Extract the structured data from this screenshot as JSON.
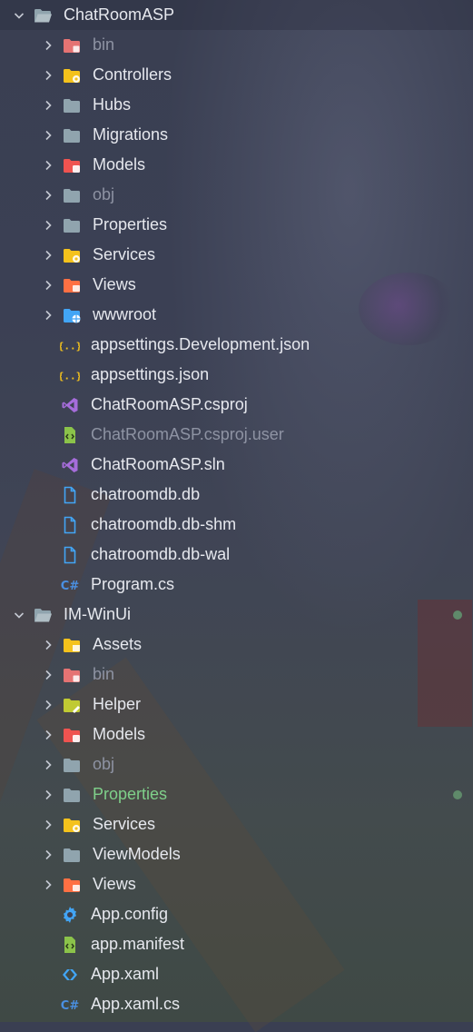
{
  "explorer": {
    "projects": [
      {
        "name": "ChatRoomASP",
        "items": [
          {
            "label": "bin",
            "kind": "folder",
            "icon": "folder-bin-icon",
            "color": "#e57373",
            "dim": true
          },
          {
            "label": "Controllers",
            "kind": "folder",
            "icon": "folder-controllers-icon",
            "color": "#f4c21c"
          },
          {
            "label": "Hubs",
            "kind": "folder",
            "icon": "folder-icon",
            "color": "#90a4ae"
          },
          {
            "label": "Migrations",
            "kind": "folder",
            "icon": "folder-icon",
            "color": "#90a4ae"
          },
          {
            "label": "Models",
            "kind": "folder",
            "icon": "folder-models-icon",
            "color": "#ef5350"
          },
          {
            "label": "obj",
            "kind": "folder",
            "icon": "folder-icon",
            "color": "#90a4ae",
            "dim": true
          },
          {
            "label": "Properties",
            "kind": "folder",
            "icon": "folder-icon",
            "color": "#90a4ae"
          },
          {
            "label": "Services",
            "kind": "folder",
            "icon": "folder-services-icon",
            "color": "#f4c21c"
          },
          {
            "label": "Views",
            "kind": "folder",
            "icon": "folder-views-icon",
            "color": "#ff7043"
          },
          {
            "label": "wwwroot",
            "kind": "folder",
            "icon": "folder-www-icon",
            "color": "#42a5f5"
          },
          {
            "label": "appsettings.Development.json",
            "kind": "file",
            "icon": "json-icon"
          },
          {
            "label": "appsettings.json",
            "kind": "file",
            "icon": "json-icon"
          },
          {
            "label": "ChatRoomASP.csproj",
            "kind": "file",
            "icon": "visual-studio-icon"
          },
          {
            "label": "ChatRoomASP.csproj.user",
            "kind": "file",
            "icon": "xml-file-icon",
            "dim": true
          },
          {
            "label": "ChatRoomASP.sln",
            "kind": "file",
            "icon": "visual-studio-icon"
          },
          {
            "label": "chatroomdb.db",
            "kind": "file",
            "icon": "file-icon"
          },
          {
            "label": "chatroomdb.db-shm",
            "kind": "file",
            "icon": "file-icon"
          },
          {
            "label": "chatroomdb.db-wal",
            "kind": "file",
            "icon": "file-icon"
          },
          {
            "label": "Program.cs",
            "kind": "file",
            "icon": "csharp-icon"
          }
        ]
      },
      {
        "name": "IM-WinUi",
        "items": [
          {
            "label": "Assets",
            "kind": "folder",
            "icon": "folder-assets-icon",
            "color": "#f4c21c"
          },
          {
            "label": "bin",
            "kind": "folder",
            "icon": "folder-bin-icon",
            "color": "#e57373",
            "dim": true
          },
          {
            "label": "Helper",
            "kind": "folder",
            "icon": "folder-helper-icon",
            "color": "#c0ca33"
          },
          {
            "label": "Models",
            "kind": "folder",
            "icon": "folder-models-icon",
            "color": "#ef5350"
          },
          {
            "label": "obj",
            "kind": "folder",
            "icon": "folder-icon",
            "color": "#90a4ae",
            "dim": true
          },
          {
            "label": "Properties",
            "kind": "folder",
            "icon": "folder-icon",
            "color": "#90a4ae",
            "green": true
          },
          {
            "label": "Services",
            "kind": "folder",
            "icon": "folder-services-icon",
            "color": "#f4c21c"
          },
          {
            "label": "ViewModels",
            "kind": "folder",
            "icon": "folder-icon",
            "color": "#90a4ae"
          },
          {
            "label": "Views",
            "kind": "folder",
            "icon": "folder-views-icon",
            "color": "#ff7043"
          },
          {
            "label": "App.config",
            "kind": "file",
            "icon": "gear-icon"
          },
          {
            "label": "app.manifest",
            "kind": "file",
            "icon": "xml-file-icon"
          },
          {
            "label": "App.xaml",
            "kind": "file",
            "icon": "xaml-icon"
          },
          {
            "label": "App.xaml.cs",
            "kind": "file",
            "icon": "csharp-icon"
          }
        ]
      }
    ]
  }
}
